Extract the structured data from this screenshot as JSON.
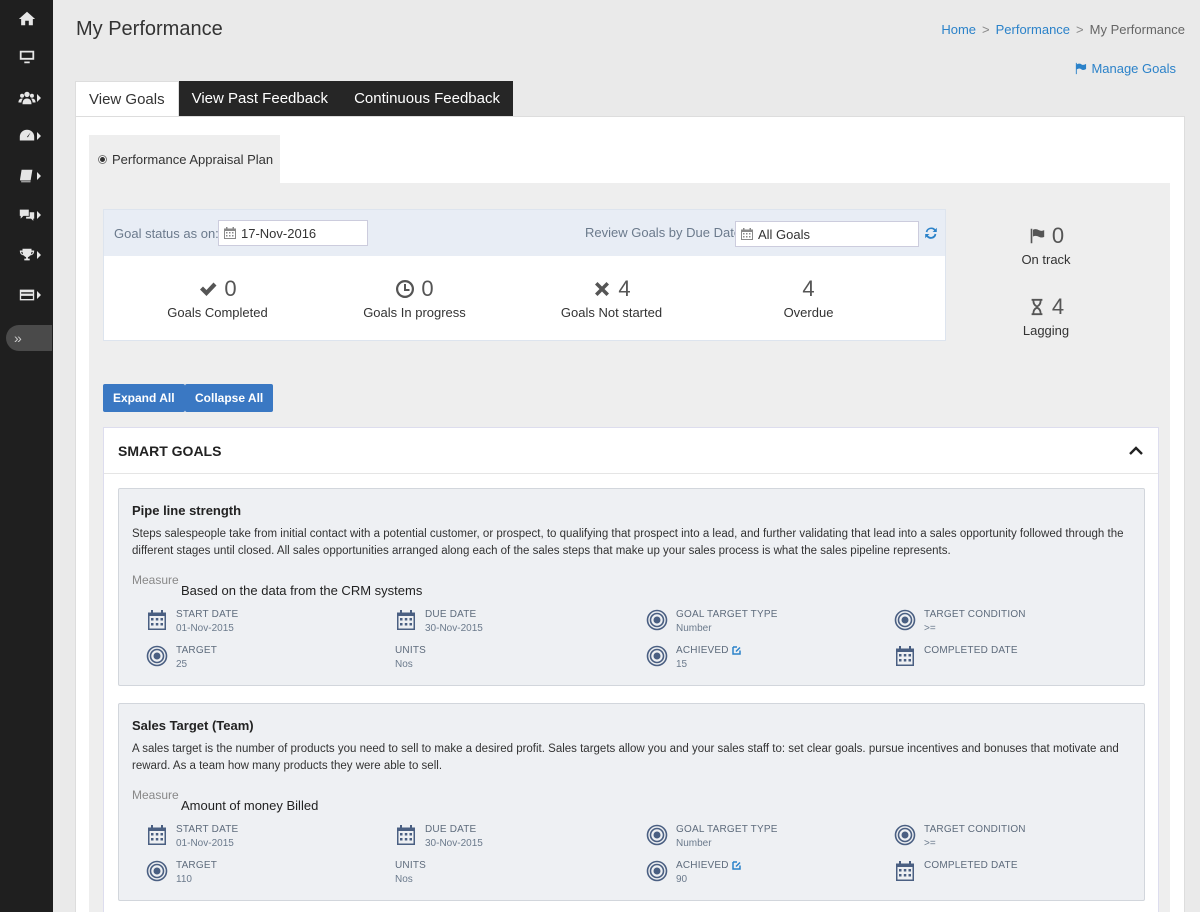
{
  "sidebar": {
    "items": [
      {
        "icon": "home-icon"
      },
      {
        "icon": "monitor-icon"
      },
      {
        "icon": "users-icon"
      },
      {
        "icon": "dashboard-icon"
      },
      {
        "icon": "book-icon"
      },
      {
        "icon": "chat-icon"
      },
      {
        "icon": "trophy-icon"
      },
      {
        "icon": "card-icon"
      }
    ],
    "toggle": "»"
  },
  "header": {
    "title": "My Performance",
    "breadcrumb": [
      "Home",
      "Performance",
      "My Performance"
    ],
    "manage_goals": "Manage Goals"
  },
  "tabs": [
    "View Goals",
    "View Past Feedback",
    "Continuous Feedback"
  ],
  "plan": {
    "label": "Performance Appraisal Plan"
  },
  "status": {
    "goal_status_label": "Goal status as on:",
    "goal_status_date": "17-Nov-2016",
    "review_label": "Review Goals by Due Date:",
    "review_value": "All Goals",
    "stats": [
      {
        "icon": "check-icon",
        "count": "0",
        "label": "Goals Completed"
      },
      {
        "icon": "clock-icon",
        "count": "0",
        "label": "Goals In progress"
      },
      {
        "icon": "x-icon",
        "count": "4",
        "label": "Goals Not started"
      },
      {
        "icon": "",
        "count": "4",
        "label": "Overdue"
      }
    ],
    "on_track": {
      "count": "0",
      "label": "On track"
    },
    "lagging": {
      "count": "4",
      "label": "Lagging"
    }
  },
  "buttons": {
    "expand_all": "Expand All",
    "collapse_all": "Collapse All"
  },
  "smart_goals": {
    "title": "SMART GOALS",
    "goals": [
      {
        "title": "Pipe line strength",
        "description": " Steps salespeople take from initial contact with a potential customer, or prospect, to qualifying that prospect into a lead, and further validating that lead into a sales opportunity followed through the different stages until closed.  All sales opportunities arranged along each of the sales steps that make up your sales process is what the sales pipeline represents.",
        "measure_label": "Measure",
        "measure_value": "Based on the data from the CRM systems",
        "start_date_label": "START DATE",
        "start_date": "01-Nov-2015",
        "due_date_label": "DUE DATE",
        "due_date": "30-Nov-2015",
        "target_type_label": "GOAL TARGET TYPE",
        "target_type": "Number",
        "target_condition_label": "TARGET CONDITION",
        "target_condition": ">=",
        "target_label": "TARGET",
        "target": "25",
        "units_label": "UNITS",
        "units": "Nos",
        "achieved_label": "ACHIEVED",
        "achieved": "15",
        "completed_date_label": "COMPLETED DATE"
      },
      {
        "title": "Sales Target (Team)",
        "description": "A sales target is the number of products you need to sell to make a desired profit.  Sales targets allow you and your sales staff to: set clear goals.  pursue incentives and bonuses that motivate and reward.  As a team how many products they were able to sell.",
        "measure_label": "Measure",
        "measure_value": "Amount of money Billed",
        "start_date_label": "START DATE",
        "start_date": "01-Nov-2015",
        "due_date_label": "DUE DATE",
        "due_date": "30-Nov-2015",
        "target_type_label": "GOAL TARGET TYPE",
        "target_type": "Number",
        "target_condition_label": "TARGET CONDITION",
        "target_condition": ">=",
        "target_label": "TARGET",
        "target": "110",
        "units_label": "UNITS",
        "units": "Nos",
        "achieved_label": "ACHIEVED",
        "achieved": "90",
        "completed_date_label": "COMPLETED DATE"
      }
    ]
  }
}
